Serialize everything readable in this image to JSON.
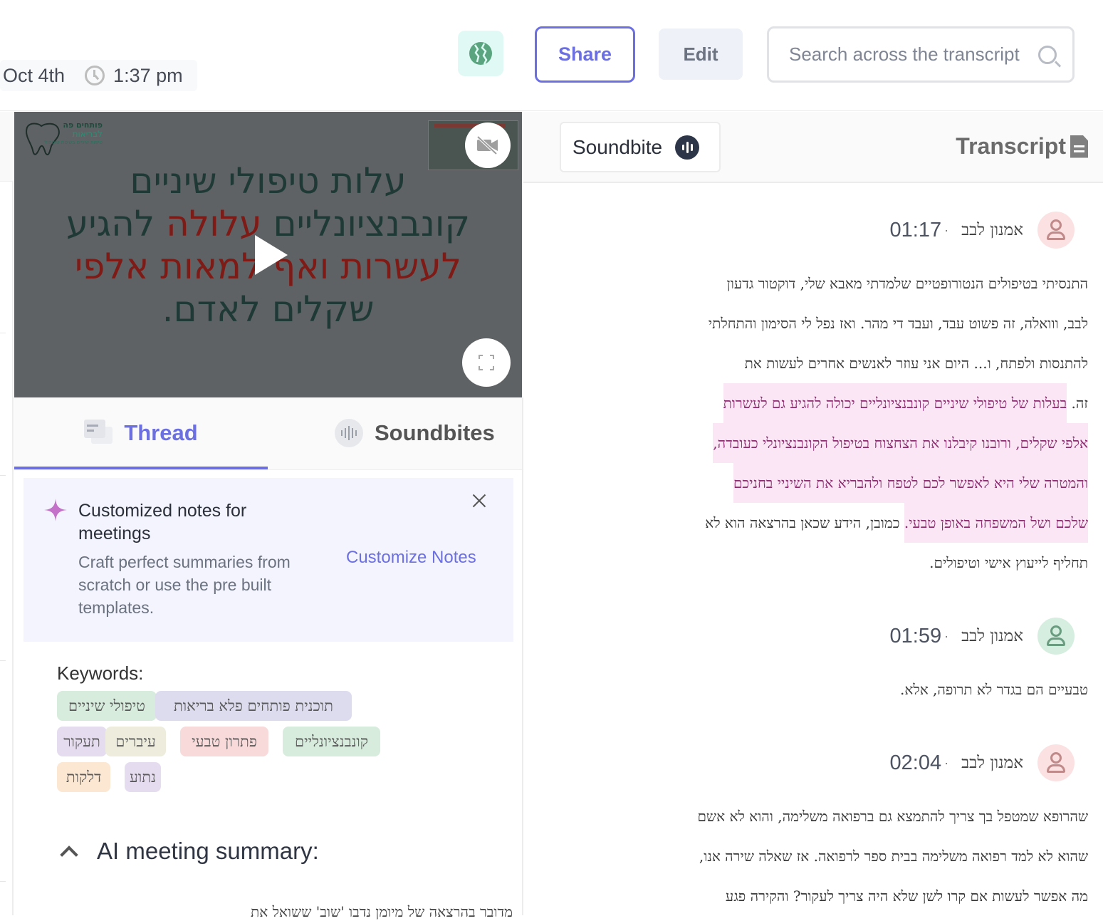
{
  "header": {
    "date": "Oct 4th",
    "time": "1:37 pm",
    "globe_icon": "globe-icon",
    "share_label": "Share",
    "edit_label": "Edit",
    "search_placeholder": "Search across the transcript"
  },
  "video": {
    "slide_lines": [
      {
        "parts": [
          {
            "text": "עלות טיפולי שיניים",
            "red": false
          }
        ]
      },
      {
        "parts": [
          {
            "text": "קונבנציונליים ",
            "red": false
          },
          {
            "text": "עלולה",
            "red": true
          },
          {
            "text": " להגיע",
            "red": false
          }
        ]
      },
      {
        "parts": [
          {
            "text": "לעשרות ואף למאות אלפי",
            "red": true
          }
        ]
      },
      {
        "parts": [
          {
            "text": "שקלים לאדם.",
            "red": false
          }
        ]
      }
    ],
    "logo_line1": "פותחים פה",
    "logo_line2": "לבריאות",
    "logo_line3": "טיפות שיניים בשיטת טופהול",
    "camera_off_icon": "camera-off-icon",
    "play_icon": "play-icon",
    "fullscreen_icon": "fullscreen-icon"
  },
  "left_tabs": {
    "thread_label": "Thread",
    "soundbites_label": "Soundbites",
    "active": "Thread"
  },
  "notes_card": {
    "title": "Customized notes for meetings",
    "description": "Craft perfect summaries from scratch or use the pre built templates.",
    "action_label": "Customize Notes",
    "accent_color": "#c471c9"
  },
  "keywords": {
    "label": "Keywords:",
    "items": [
      {
        "text": "טיפולי שיניים",
        "color": "#d7ecdc"
      },
      {
        "text": "תוכנית פותחים פלא בריאות",
        "color": "#dcdcee"
      },
      {
        "text": "תעקור",
        "color": "#e6dcf0"
      },
      {
        "text": "עיברים",
        "color": "#eeeddd"
      },
      {
        "text": "פתרון טבעי",
        "color": "#f8dada"
      },
      {
        "text": "קונבנציונליים",
        "color": "#d7ecdc"
      },
      {
        "text": "דלקות",
        "color": "#fbe7d2"
      },
      {
        "text": "נתוע",
        "color": "#e6dcf0"
      }
    ]
  },
  "ai_summary": {
    "label": "AI meeting summary:",
    "expanded": true,
    "first_bullet_partial": "מדובר בהרצאה של מיומן נדבו 'שוב' ששואל את"
  },
  "right_panel": {
    "soundbite_label": "Soundbite",
    "transcript_label": "Transcript",
    "entries": [
      {
        "speaker": "אמנון לבב",
        "time": "01:17",
        "avatar_bg": "#fbe1e1",
        "avatar_fg": "#c08a8a",
        "lines": [
          {
            "plain": "התנסיתי בטיפולים הנטורופטיים שלמדתי מאבא שלי, דוקטור גדעון",
            "hl": ""
          },
          {
            "plain": "לבב, ווואלה, זה פשוט עבד, ועבד די מהר. ואז נפל לי הסימון והתחלתי",
            "hl": ""
          },
          {
            "plain": "להתנסות ולפתח, ו... היום אני עוזר לאנשים אחרים לעשות את",
            "hl": ""
          },
          {
            "plain": "זה. ",
            "hl": "בעלות של טיפולי שיניים קונבנציונליים יכולה להגיע גם לעשרות",
            "hl_first": false
          },
          {
            "plain": "",
            "hl": "אלפי שקלים, ורובנו קיבלנו את הצחצוח בטיפול הקונבנציונלי כעובדה,"
          },
          {
            "plain": "",
            "hl": "והמטרה שלי היא לאפשר לכם לטפח ולהבריא את השיניי בחניכם"
          },
          {
            "plain": " כמובן, הידע שכאן בהרצאה הוא לא",
            "hl": "שלכם ושל המשפחה באופן טבעי.",
            "hl_first": true
          },
          {
            "plain": "תחליף לייעוץ אישי וטיפולים.",
            "hl": ""
          }
        ]
      },
      {
        "speaker": "אמנון לבב",
        "time": "01:59",
        "avatar_bg": "#d6eedf",
        "avatar_fg": "#6a9c80",
        "lines": [
          {
            "plain": "טבעיים הם בגדר לא תרופה, אלא.",
            "hl": ""
          }
        ]
      },
      {
        "speaker": "אמנון לבב",
        "time": "02:04",
        "avatar_bg": "#fbe1e1",
        "avatar_fg": "#c08a8a",
        "lines": [
          {
            "plain": "שהרופא שמטפל בך צריך להתמצא גם ברפואה משלימה, והוא לא אשם",
            "hl": ""
          },
          {
            "plain": "שהוא לא למד רפואה משלימה בבית ספר לרפואה. אז שאלה שירה אנו,",
            "hl": ""
          },
          {
            "plain": "מה אפשר לעשות אם קרו לשן שלא היה צריך לעקור? והקירה פגע",
            "hl": ""
          }
        ]
      }
    ]
  },
  "colors": {
    "accent": "#6c6fe0",
    "highlight_bg": "#fbe6f5",
    "highlight_text": "#8c2c6f"
  }
}
